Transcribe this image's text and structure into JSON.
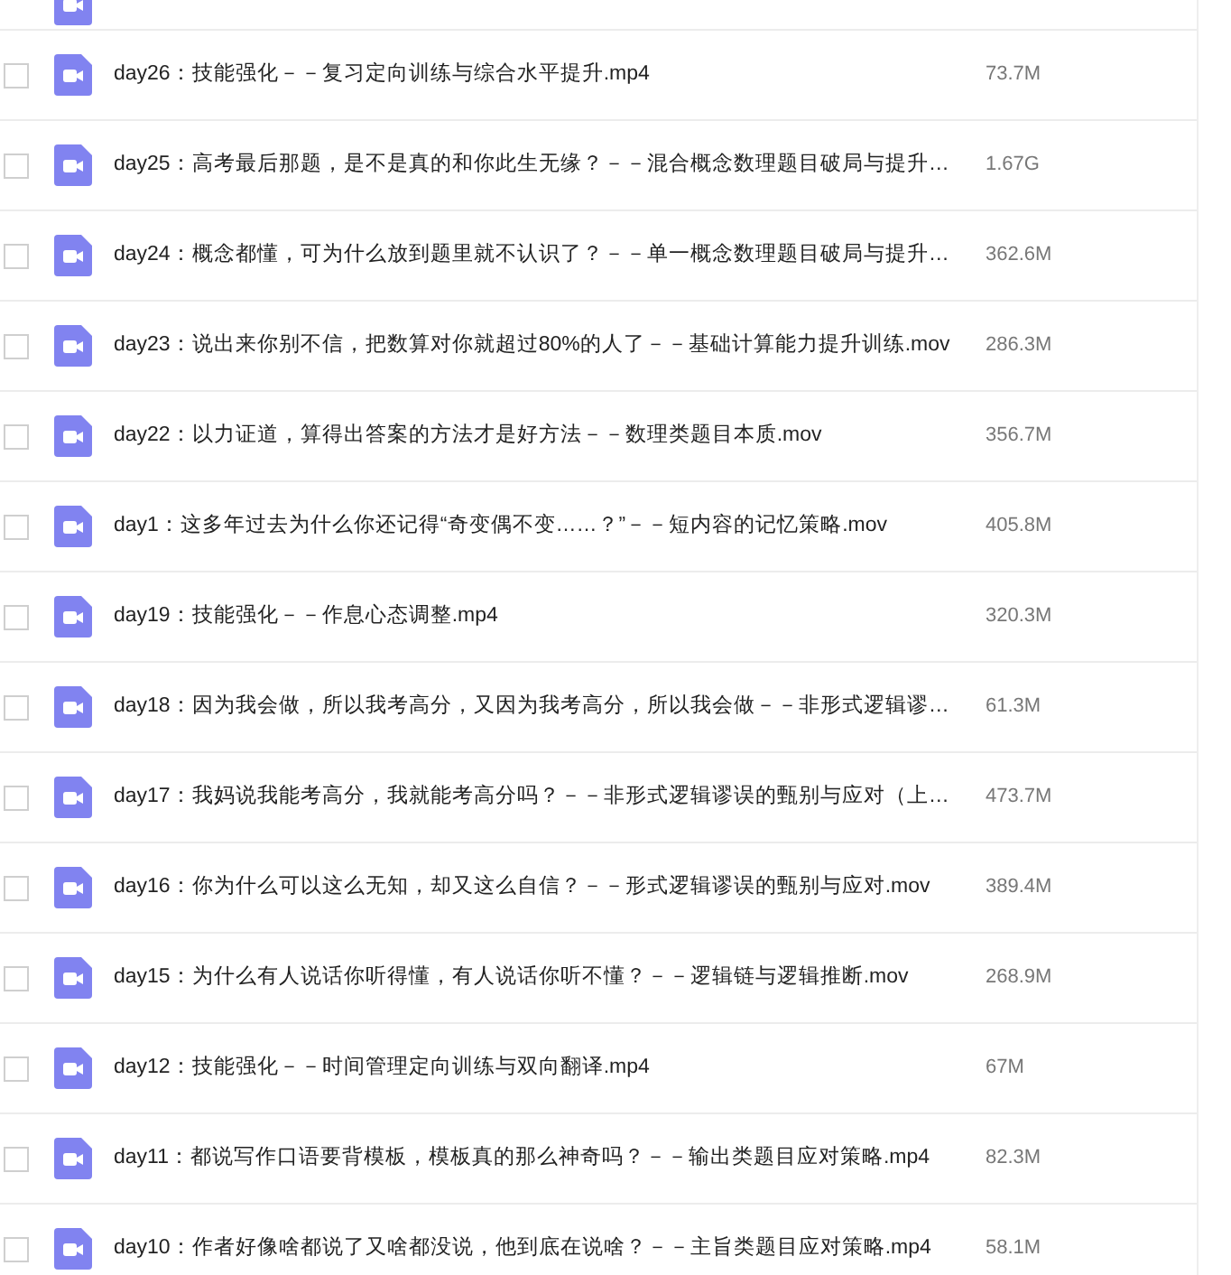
{
  "files": [
    {
      "name": "day26：技能强化－－复习定向训练与综合水平提升.mp4",
      "size": "73.7M",
      "checked": false
    },
    {
      "name": "day25：高考最后那题，是不是真的和你此生无缘？－－混合概念数理题目破局与提升…",
      "size": "1.67G",
      "checked": false
    },
    {
      "name": "day24：概念都懂，可为什么放到题里就不认识了？－－单一概念数理题目破局与提升…",
      "size": "362.6M",
      "checked": false
    },
    {
      "name": "day23：说出来你别不信，把数算对你就超过80%的人了－－基础计算能力提升训练.mov",
      "size": "286.3M",
      "checked": false
    },
    {
      "name": "day22：以力证道，算得出答案的方法才是好方法－－数理类题目本质.mov",
      "size": "356.7M",
      "checked": false
    },
    {
      "name": "day1：这多年过去为什么你还记得“奇变偶不变……？”－－短内容的记忆策略.mov",
      "size": "405.8M",
      "checked": false
    },
    {
      "name": "day19：技能强化－－作息心态调整.mp4",
      "size": "320.3M",
      "checked": false
    },
    {
      "name": "day18：因为我会做，所以我考高分，又因为我考高分，所以我会做－－非形式逻辑谬…",
      "size": "61.3M",
      "checked": false
    },
    {
      "name": "day17：我妈说我能考高分，我就能考高分吗？－－非形式逻辑谬误的甄别与应对（上…",
      "size": "473.7M",
      "checked": false
    },
    {
      "name": "day16：你为什么可以这么无知，却又这么自信？－－形式逻辑谬误的甄别与应对.mov",
      "size": "389.4M",
      "checked": false
    },
    {
      "name": "day15：为什么有人说话你听得懂，有人说话你听不懂？－－逻辑链与逻辑推断.mov",
      "size": "268.9M",
      "checked": false
    },
    {
      "name": "day12：技能强化－－时间管理定向训练与双向翻译.mp4",
      "size": "67M",
      "checked": false
    },
    {
      "name": "day11：都说写作口语要背模板，模板真的那么神奇吗？－－输出类题目应对策略.mp4",
      "size": "82.3M",
      "checked": false
    },
    {
      "name": "day10：作者好像啥都说了又啥都没说，他到底在说啥？－－主旨类题目应对策略.mp4",
      "size": "58.1M",
      "checked": false
    }
  ]
}
